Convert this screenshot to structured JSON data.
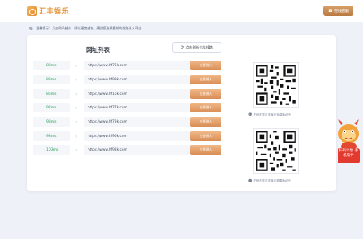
{
  "header": {
    "logo_text": "汇丰娱乐",
    "service_label": "在线客服"
  },
  "notice": {
    "text": "温馨提示：反应时间越小，网站速度越快，建议您选择靠前的线路进入网站"
  },
  "list": {
    "title": "网址列表",
    "refresh_label": "点击刷新全部线路",
    "rows": [
      {
        "ms": "83ms",
        "url": "https://www.hf76k.com",
        "button": "立即进入"
      },
      {
        "ms": "83ms",
        "url": "https://www.hf99k.com",
        "button": "立即进入"
      },
      {
        "ms": "86ms",
        "url": "https://www.hf16k.com",
        "button": "立即进入"
      },
      {
        "ms": "92ms",
        "url": "https://www.hf77k.com",
        "button": "立即进入"
      },
      {
        "ms": "93ms",
        "url": "https://www.hf79k.com",
        "button": "立即进入"
      },
      {
        "ms": "98ms",
        "url": "https://www.hf96k.com",
        "button": "立即进入"
      },
      {
        "ms": "103ms",
        "url": "https://www.hf98k.com",
        "button": "立即进入"
      }
    ]
  },
  "downloads": {
    "android_caption": "扫码下载汇丰娱乐安卓版APP",
    "ios_caption": "扫码下载汇丰娱乐苹果版APP"
  },
  "promo": {
    "label": "扫码计划 手机软件"
  },
  "colors": {
    "accent": "#d98d55",
    "latency": "#2aa35b",
    "promo": "#e23a2f"
  }
}
